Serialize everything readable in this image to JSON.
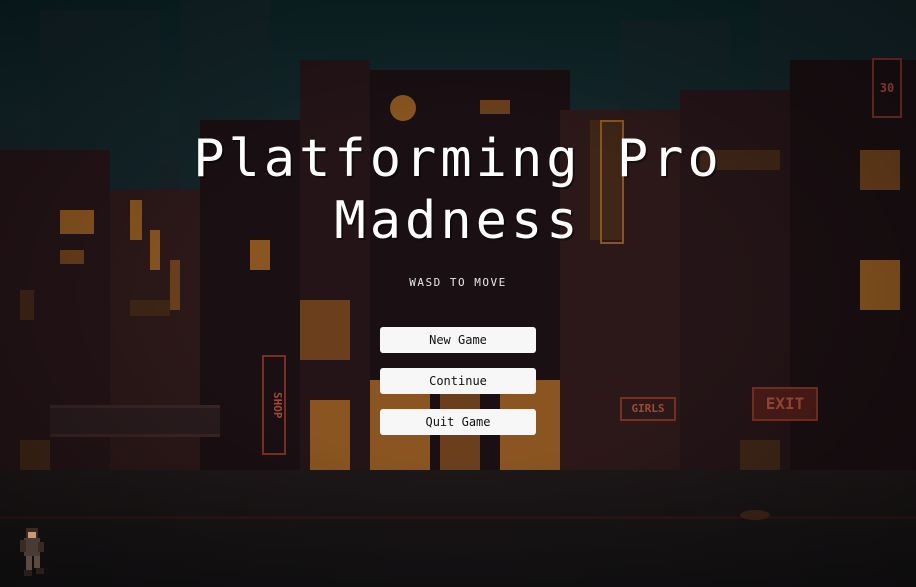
{
  "game": {
    "title_line1": "Platforming Pro",
    "title_line2": "Madness",
    "hint": "WASD TO MOVE"
  },
  "menu": {
    "new_game_label": "New Game",
    "continue_label": "Continue",
    "quit_label": "Quit Game"
  },
  "scenery": {
    "signs": {
      "shop": "SHOP",
      "girls": "GIRLS",
      "exit": "EXIT",
      "corner": "30"
    }
  },
  "colors": {
    "title_text": "#ffffff",
    "button_bg": "#f7f7f7",
    "button_text": "#111111",
    "neon_red": "#a04a32"
  }
}
